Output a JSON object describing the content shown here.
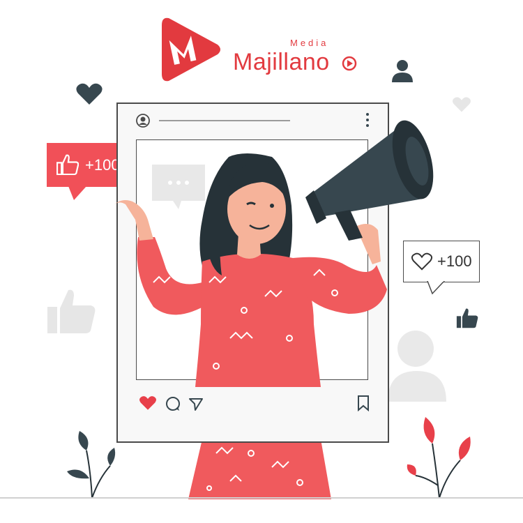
{
  "brand": {
    "name": "Majillano",
    "tagline": "Media",
    "logo_icon": "play-m-logo-icon",
    "accent_color": "#e23a3f"
  },
  "badges": {
    "likes": {
      "icon": "thumbs-up-icon",
      "count": "+100",
      "color": "#f15058"
    },
    "hearts": {
      "icon": "heart-outline-icon",
      "count": "+100",
      "color": "#4a4a4a"
    }
  },
  "post": {
    "header_icons": [
      "profile-icon",
      "more-vertical-icon"
    ],
    "action_icons": [
      "heart-icon",
      "comment-icon",
      "send-icon",
      "bookmark-icon"
    ]
  },
  "colors": {
    "figure_red": "#f05a5d",
    "hair": "#263238",
    "skin": "#f6b39a",
    "megaphone": "#37474f",
    "outline": "#4a4a4a"
  }
}
